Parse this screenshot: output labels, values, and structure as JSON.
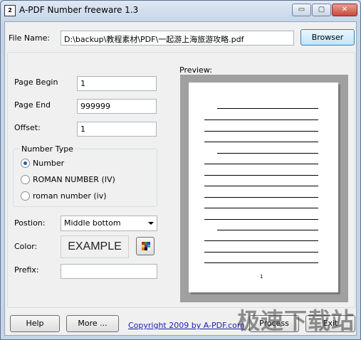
{
  "window": {
    "title": "A-PDF Number freeware 1.3",
    "icon_text": "2",
    "controls": {
      "minimize": "▭",
      "maximize": "▢",
      "close": "✕"
    }
  },
  "file": {
    "label": "File Name:",
    "value": "D:\\backup\\教程素材\\PDF\\一起游上海旅游攻略.pdf",
    "browse_label": "Browser"
  },
  "page_begin": {
    "label": "Page Begin",
    "value": "1"
  },
  "page_end": {
    "label": "Page End",
    "value": "999999"
  },
  "offset": {
    "label": "Offset:",
    "value": "1"
  },
  "number_type": {
    "title": "Number Type",
    "options": [
      {
        "label": "Number",
        "selected": true
      },
      {
        "label": "ROMAN NUMBER (IV)",
        "selected": false
      },
      {
        "label": "roman number (iv)",
        "selected": false
      }
    ]
  },
  "position": {
    "label": "Postion:",
    "value": "Middle bottom"
  },
  "color": {
    "label": "Color:",
    "example_text": "EXAMPLE",
    "picker_colors": [
      "#d02020",
      "#20a020",
      "#2040d0",
      "#e0d020",
      "#8020a0",
      "#20b0c0",
      "#e07020",
      "#000000",
      "#ffffff"
    ]
  },
  "prefix": {
    "label": "Prefix:",
    "value": ""
  },
  "preview": {
    "label": "Preview:",
    "page_number": "1"
  },
  "footer": {
    "help_label": "Help",
    "more_label": "More ...",
    "link_text": "Copyright 2009 by A-PDF.com",
    "process_label": "Process",
    "exit_label": "Exit"
  },
  "watermark": "极速下载站"
}
